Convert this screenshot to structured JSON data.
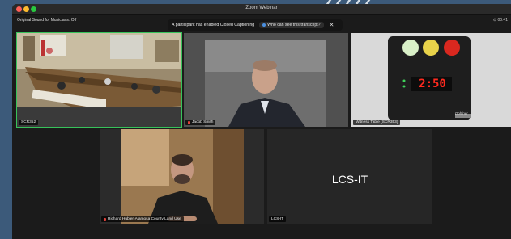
{
  "window": {
    "title": "Zoom Webinar"
  },
  "top": {
    "original_sound": "Original Sound for Musicians: Off",
    "timer": "00:41"
  },
  "cc_banner": {
    "text": "A participant has enabled Closed Captioning",
    "button_label": "Who can see this transcript?",
    "close_glyph": "✕"
  },
  "tiles": {
    "t1": {
      "name": "SCR352"
    },
    "t2": {
      "name": "Jacob Smith"
    },
    "t3": {
      "name": "Witness Table (SCR353)",
      "clock": "2:50",
      "brand": "Dohlner"
    },
    "t4": {
      "name": "Richard Hubler-Alamosa County Land Use"
    },
    "t5": {
      "name": "LCS-IT",
      "display_name": "LCS-IT"
    }
  },
  "colors": {
    "active_speaker": "#37c25a",
    "mic_off": "#e0413a",
    "background": "#1b1b1b"
  }
}
